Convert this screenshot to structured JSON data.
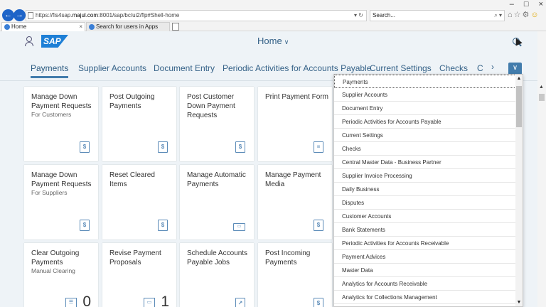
{
  "browser": {
    "url_prefix": "https://fis4sap.",
    "url_domain": "majul.com",
    "url_suffix": ":8001/sap/bc/ui2/flp#Shell-home",
    "search_placeholder": "Search...",
    "tabs": [
      {
        "label": "Home",
        "close": "×"
      },
      {
        "label": "Search for users in Apps",
        "close": "×"
      }
    ],
    "window_controls": [
      "–",
      "□",
      "×"
    ]
  },
  "shell": {
    "logo": "SAP",
    "title": "Home"
  },
  "nav_tabs": [
    "Payments",
    "Supplier Accounts",
    "Document Entry",
    "Periodic Activities for Accounts Payable",
    "Current Settings",
    "Checks",
    "C"
  ],
  "tiles": [
    {
      "title": "Manage Down Payment Requests",
      "subtitle": "For Customers",
      "icon": "down-payment-icon"
    },
    {
      "title": "Post Outgoing Payments",
      "subtitle": "",
      "icon": "payment-document-icon"
    },
    {
      "title": "Post Customer Down Payment Requests",
      "subtitle": "",
      "icon": "customer-payment-icon"
    },
    {
      "title": "Print Payment Form",
      "subtitle": "",
      "icon": "print-form-icon"
    },
    {
      "title": "Manage Down Payment Requests",
      "subtitle": "For Suppliers",
      "icon": "down-payment-icon"
    },
    {
      "title": "Reset Cleared Items",
      "subtitle": "",
      "icon": "reset-cleared-icon"
    },
    {
      "title": "Manage Automatic Payments",
      "subtitle": "",
      "icon": "automatic-payment-icon"
    },
    {
      "title": "Manage Payment Media",
      "subtitle": "",
      "icon": "payment-media-icon"
    },
    {
      "title": "Clear Outgoing Payments",
      "subtitle": "Manual Clearing",
      "icon": "list-icon",
      "count": "0"
    },
    {
      "title": "Revise Payment Proposals",
      "subtitle": "",
      "icon": "payment-card-icon",
      "count": "1"
    },
    {
      "title": "Schedule Accounts Payable Jobs",
      "subtitle": "",
      "icon": "schedule-jobs-icon"
    },
    {
      "title": "Post Incoming Payments",
      "subtitle": "",
      "icon": "payment-document-icon"
    }
  ],
  "dropdown_items": [
    "Payments",
    "Supplier Accounts",
    "Document Entry",
    "Periodic Activities for Accounts Payable",
    "Current Settings",
    "Checks",
    "Central Master Data - Business Partner",
    "Supplier Invoice Processing",
    "Daily Business",
    "Disputes",
    "Customer Accounts",
    "Bank Statements",
    "Periodic Activities for Accounts Receivable",
    "Payment Advices",
    "Master Data",
    "Analytics for Accounts Receivable",
    "Analytics for Collections Management"
  ]
}
